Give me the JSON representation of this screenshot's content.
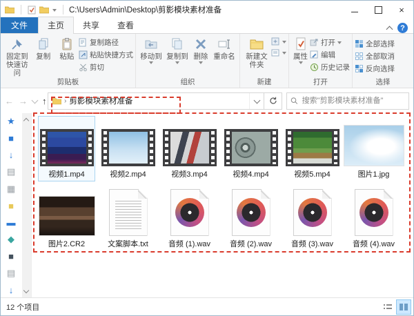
{
  "window": {
    "path": "C:\\Users\\Admin\\Desktop\\剪影模块素材准备"
  },
  "tabs": {
    "file": "文件",
    "home": "主页",
    "share": "共享",
    "view": "查看"
  },
  "ribbon": {
    "pin": "固定到快速访问",
    "copy": "复制",
    "paste": "粘贴",
    "copy_path": "复制路径",
    "paste_shortcut": "粘贴快捷方式",
    "cut": "剪切",
    "clipboard_group": "剪贴板",
    "move_to": "移动到",
    "copy_to": "复制到",
    "delete": "删除",
    "rename": "重命名",
    "organize_group": "组织",
    "new_folder": "新建文件夹",
    "new_group": "新建",
    "properties": "属性",
    "open": "打开",
    "edit": "编辑",
    "history": "历史记录",
    "open_group": "打开",
    "select_all": "全部选择",
    "select_none": "全部取消",
    "invert_selection": "反向选择",
    "select_group": "选择"
  },
  "address": {
    "folder": "剪影模块素材准备",
    "search_placeholder": "搜索\"剪影模块素材准备\""
  },
  "sidebar": {
    "icons": [
      {
        "glyph": "★"
      },
      {
        "glyph": "■"
      },
      {
        "glyph": "↓"
      },
      {
        "glyph": "▤"
      },
      {
        "glyph": "▦"
      },
      {
        "glyph": "■"
      },
      {
        "glyph": "▬"
      },
      {
        "glyph": "◆"
      },
      {
        "glyph": "■"
      },
      {
        "glyph": "▤"
      },
      {
        "glyph": "↓"
      }
    ]
  },
  "files": [
    {
      "name": "视频1.mp4",
      "kind": "video1",
      "selected": true
    },
    {
      "name": "视频2.mp4",
      "kind": "video2"
    },
    {
      "name": "视频3.mp4",
      "kind": "video3"
    },
    {
      "name": "视频4.mp4",
      "kind": "video4"
    },
    {
      "name": "视频5.mp4",
      "kind": "video5"
    },
    {
      "name": "图片1.jpg",
      "kind": "pic-sky"
    },
    {
      "name": "图片2.CR2",
      "kind": "pic-dark"
    },
    {
      "name": "文案脚本.txt",
      "kind": "doc-txt"
    },
    {
      "name": "音频 (1).wav",
      "kind": "audio"
    },
    {
      "name": "音频 (2).wav",
      "kind": "audio"
    },
    {
      "name": "音频 (3).wav",
      "kind": "audio"
    },
    {
      "name": "音频 (4).wav",
      "kind": "audio"
    }
  ],
  "status": {
    "items": "12 个项目"
  },
  "colors": {
    "accent_blue": "#2472bd",
    "annotation_red": "#d93a2b",
    "selection_border": "#a9d4f0"
  }
}
